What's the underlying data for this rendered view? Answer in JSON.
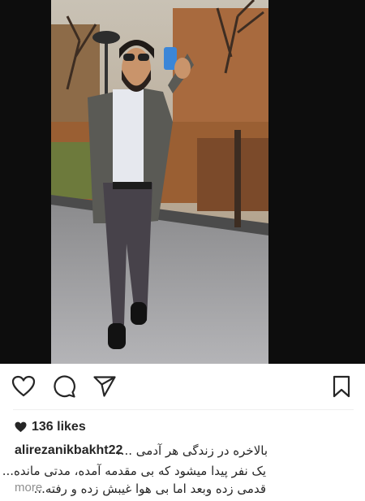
{
  "post": {
    "likes_count": "136 likes",
    "username": "alirezanikbakht22",
    "caption_lines": [
      "بالاخره در زندگی هر آدمی ...،",
      "یک نفر پیدا میشود که بی مقدمه آمده، مدتی مانده...",
      "قدمی زده وبعد اما بی هوا غیبش زده و رفته..."
    ],
    "more_label": "more"
  },
  "icons": {
    "like": "heart-outline-icon",
    "comment": "comment-bubble-icon",
    "share": "paper-plane-icon",
    "save": "bookmark-icon",
    "likes": "heart-filled-icon"
  },
  "colors": {
    "text": "#262626",
    "muted": "#8e8e8e",
    "photo_background": "#0d0d0d",
    "divider": "#efefef"
  }
}
